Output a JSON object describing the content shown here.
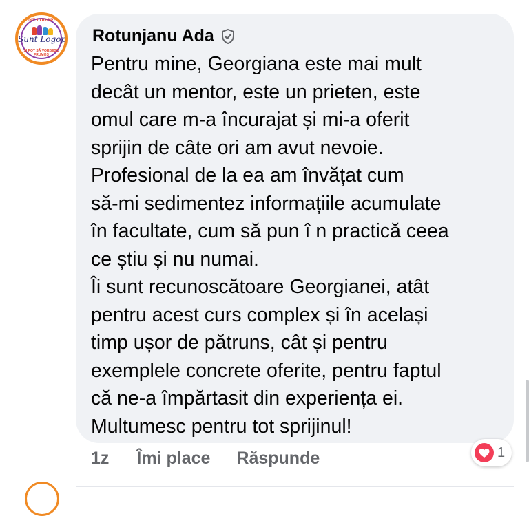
{
  "comment": {
    "avatar": {
      "top_text": "SUNT LOGOPED",
      "main_text": "Sunt Logoped",
      "bottom_text": "ȘI POT SĂ VORBESC FRUMOS",
      "icon": "logo-avatar"
    },
    "author_name": "Rotunjanu Ada",
    "author_badge_icon": "shield-check-icon",
    "text": "Pentru mine, Georgiana este mai mult\ndecât  un mentor, este un prieten, este\nomul care m-a încurajat și mi-a oferit\nsprijin de câte ori am avut nevoie.\nProfesional de la ea am învățat cum\nsă-mi sedimentez informațiile acumulate\nîn facultate, cum să pun î n practică ceea\nce știu și nu numai.\nÎi sunt recunoscătoare Georgianei, atât\npentru acest curs complex și în același\ntimp ușor de pătruns, cât și pentru\nexemplele concrete oferite, pentru faptul\ncă ne-a împărtasit din experiența ei.\nMultumesc pentru tot sprijinul!",
    "bubble_color": "#f0f2f5"
  },
  "actions": {
    "time": "1z",
    "like_label": "Îmi place",
    "reply_label": "Răspunde"
  },
  "reactions": {
    "icon": "heart-icon",
    "color": "#f33e58",
    "count": "1"
  }
}
